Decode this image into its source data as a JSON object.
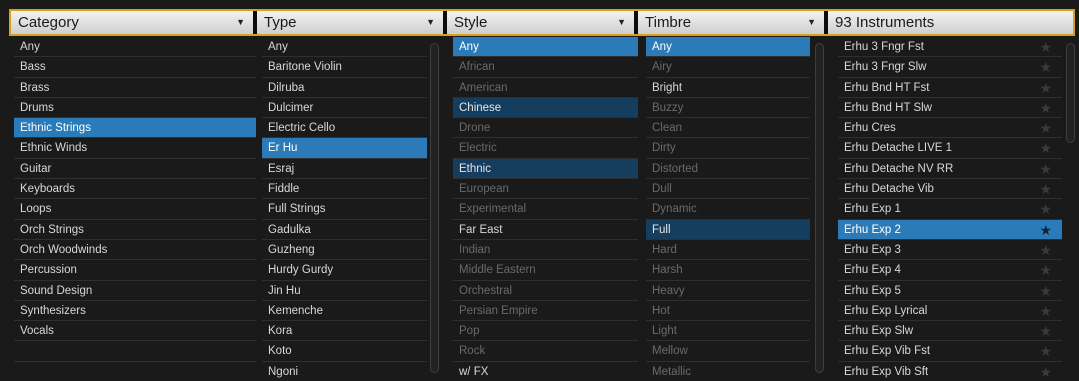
{
  "headers": {
    "category": "Category",
    "type": "Type",
    "style": "Style",
    "timbre": "Timbre",
    "instruments": "93 Instruments",
    "arrow": "▼"
  },
  "category": [
    {
      "label": "Any",
      "state": ""
    },
    {
      "label": "Bass",
      "state": ""
    },
    {
      "label": "Brass",
      "state": ""
    },
    {
      "label": "Drums",
      "state": ""
    },
    {
      "label": "Ethnic Strings",
      "state": "sel"
    },
    {
      "label": "Ethnic Winds",
      "state": ""
    },
    {
      "label": "Guitar",
      "state": ""
    },
    {
      "label": "Keyboards",
      "state": ""
    },
    {
      "label": "Loops",
      "state": ""
    },
    {
      "label": "Orch Strings",
      "state": ""
    },
    {
      "label": "Orch Woodwinds",
      "state": ""
    },
    {
      "label": "Percussion",
      "state": ""
    },
    {
      "label": "Sound Design",
      "state": ""
    },
    {
      "label": "Synthesizers",
      "state": ""
    },
    {
      "label": "Vocals",
      "state": ""
    },
    {
      "label": "",
      "state": ""
    },
    {
      "label": "",
      "state": ""
    }
  ],
  "type": [
    {
      "label": "Any",
      "state": ""
    },
    {
      "label": "Baritone Violin",
      "state": ""
    },
    {
      "label": "Dilruba",
      "state": ""
    },
    {
      "label": "Dulcimer",
      "state": ""
    },
    {
      "label": "Electric Cello",
      "state": ""
    },
    {
      "label": "Er Hu",
      "state": "sel"
    },
    {
      "label": "Esraj",
      "state": ""
    },
    {
      "label": "Fiddle",
      "state": ""
    },
    {
      "label": "Full Strings",
      "state": ""
    },
    {
      "label": "Gadulka",
      "state": ""
    },
    {
      "label": "Guzheng",
      "state": ""
    },
    {
      "label": "Hurdy Gurdy",
      "state": ""
    },
    {
      "label": "Jin Hu",
      "state": ""
    },
    {
      "label": "Kemenche",
      "state": ""
    },
    {
      "label": "Kora",
      "state": ""
    },
    {
      "label": "Koto",
      "state": ""
    },
    {
      "label": "Ngoni",
      "state": ""
    }
  ],
  "style": [
    {
      "label": "Any",
      "state": "sel"
    },
    {
      "label": "African",
      "state": "dim"
    },
    {
      "label": "American",
      "state": "dim"
    },
    {
      "label": "Chinese",
      "state": "hl"
    },
    {
      "label": "Drone",
      "state": "dim"
    },
    {
      "label": "Electric",
      "state": "dim"
    },
    {
      "label": "Ethnic",
      "state": "hl"
    },
    {
      "label": "European",
      "state": "dim"
    },
    {
      "label": "Experimental",
      "state": "dim"
    },
    {
      "label": "Far East",
      "state": ""
    },
    {
      "label": "Indian",
      "state": "dim"
    },
    {
      "label": "Middle Eastern",
      "state": "dim"
    },
    {
      "label": "Orchestral",
      "state": "dim"
    },
    {
      "label": "Persian Empire",
      "state": "dim"
    },
    {
      "label": "Pop",
      "state": "dim"
    },
    {
      "label": "Rock",
      "state": "dim"
    },
    {
      "label": "w/ FX",
      "state": ""
    }
  ],
  "timbre": [
    {
      "label": "Any",
      "state": "sel"
    },
    {
      "label": "Airy",
      "state": "dim"
    },
    {
      "label": "Bright",
      "state": ""
    },
    {
      "label": "Buzzy",
      "state": "dim"
    },
    {
      "label": "Clean",
      "state": "dim"
    },
    {
      "label": "Dirty",
      "state": "dim"
    },
    {
      "label": "Distorted",
      "state": "dim"
    },
    {
      "label": "Dull",
      "state": "dim"
    },
    {
      "label": "Dynamic",
      "state": "dim"
    },
    {
      "label": "Full",
      "state": "hl"
    },
    {
      "label": "Hard",
      "state": "dim"
    },
    {
      "label": "Harsh",
      "state": "dim"
    },
    {
      "label": "Heavy",
      "state": "dim"
    },
    {
      "label": "Hot",
      "state": "dim"
    },
    {
      "label": "Light",
      "state": "dim"
    },
    {
      "label": "Mellow",
      "state": "dim"
    },
    {
      "label": "Metallic",
      "state": "dim"
    }
  ],
  "instruments": [
    {
      "label": "Erhu 3 Fngr Fst",
      "state": ""
    },
    {
      "label": "Erhu 3 Fngr Slw",
      "state": ""
    },
    {
      "label": "Erhu Bnd HT Fst",
      "state": ""
    },
    {
      "label": "Erhu Bnd HT Slw",
      "state": ""
    },
    {
      "label": "Erhu Cres",
      "state": ""
    },
    {
      "label": "Erhu Detache LIVE 1",
      "state": ""
    },
    {
      "label": "Erhu Detache NV RR",
      "state": ""
    },
    {
      "label": "Erhu Detache Vib",
      "state": ""
    },
    {
      "label": "Erhu Exp 1",
      "state": ""
    },
    {
      "label": "Erhu Exp 2",
      "state": "sel"
    },
    {
      "label": "Erhu Exp 3",
      "state": ""
    },
    {
      "label": "Erhu Exp 4",
      "state": ""
    },
    {
      "label": "Erhu Exp 5",
      "state": ""
    },
    {
      "label": "Erhu Exp Lyrical",
      "state": ""
    },
    {
      "label": "Erhu Exp Slw",
      "state": ""
    },
    {
      "label": "Erhu Exp Vib Fst",
      "state": ""
    },
    {
      "label": "Erhu Exp Vib Sft",
      "state": ""
    }
  ],
  "star_glyph": "★",
  "colors": {
    "accent_border": "#d6a021",
    "selected": "#2a7bb8",
    "highlight": "#153e5e"
  }
}
